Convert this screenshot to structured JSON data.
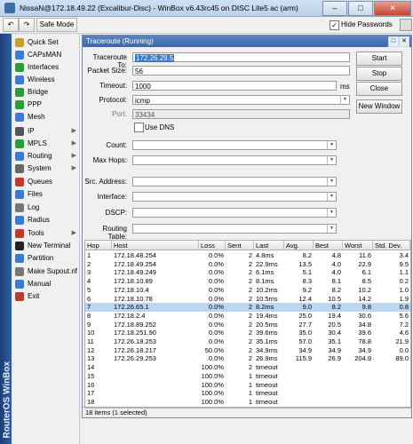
{
  "window": {
    "title": "NissaN@172.18.49.22 (Excalibur-Disc) - WinBox v6.43rc45 on DISC Lite5 ac (arm)"
  },
  "toolbar": {
    "safe_mode_label": "Safe Mode",
    "hide_passwords_label": "Hide Passwords",
    "hide_passwords_checked": true
  },
  "sidebar": {
    "brand": "RouterOS WinBox",
    "items": [
      {
        "label": "Quick Set",
        "icon": "quick-set-icon",
        "submenu": false,
        "color": "#c8a030"
      },
      {
        "label": "CAPsMAN",
        "icon": "capsman-icon",
        "submenu": false,
        "color": "#3a7bd5"
      },
      {
        "label": "Interfaces",
        "icon": "interfaces-icon",
        "submenu": false,
        "color": "#2a9d3a"
      },
      {
        "label": "Wireless",
        "icon": "wireless-icon",
        "submenu": false,
        "color": "#3a7bd5"
      },
      {
        "label": "Bridge",
        "icon": "bridge-icon",
        "submenu": false,
        "color": "#2a9d3a"
      },
      {
        "label": "PPP",
        "icon": "ppp-icon",
        "submenu": false,
        "color": "#2a9d3a"
      },
      {
        "label": "Mesh",
        "icon": "mesh-icon",
        "submenu": false,
        "color": "#3a7bd5"
      },
      {
        "label": "IP",
        "icon": "ip-icon",
        "submenu": true,
        "color": "#555555"
      },
      {
        "label": "MPLS",
        "icon": "mpls-icon",
        "submenu": true,
        "color": "#2a9d3a"
      },
      {
        "label": "Routing",
        "icon": "routing-icon",
        "submenu": true,
        "color": "#3a7bd5"
      },
      {
        "label": "System",
        "icon": "system-icon",
        "submenu": true,
        "color": "#666666"
      },
      {
        "label": "Queues",
        "icon": "queues-icon",
        "submenu": false,
        "color": "#c0392b"
      },
      {
        "label": "Files",
        "icon": "files-icon",
        "submenu": false,
        "color": "#3a7bd5"
      },
      {
        "label": "Log",
        "icon": "log-icon",
        "submenu": false,
        "color": "#777777"
      },
      {
        "label": "Radius",
        "icon": "radius-icon",
        "submenu": false,
        "color": "#3a7bd5"
      },
      {
        "label": "Tools",
        "icon": "tools-icon",
        "submenu": true,
        "color": "#c0392b"
      },
      {
        "label": "New Terminal",
        "icon": "terminal-icon",
        "submenu": false,
        "color": "#222222"
      },
      {
        "label": "Partition",
        "icon": "partition-icon",
        "submenu": false,
        "color": "#3a7bd5"
      },
      {
        "label": "Make Supout.rif",
        "icon": "supout-icon",
        "submenu": false,
        "color": "#777777"
      },
      {
        "label": "Manual",
        "icon": "manual-icon",
        "submenu": false,
        "color": "#3a7bd5"
      },
      {
        "label": "Exit",
        "icon": "exit-icon",
        "submenu": false,
        "color": "#c0392b"
      }
    ]
  },
  "dialog": {
    "title": "Traceroute (Running)",
    "form": {
      "traceroute_to_label": "Traceroute To:",
      "traceroute_to_value": "172.26.29.5",
      "packet_size_label": "Packet Size:",
      "packet_size_value": "56",
      "timeout_label": "Timeout:",
      "timeout_value": "1000",
      "timeout_unit": "ms",
      "protocol_label": "Protocol:",
      "protocol_value": "icmp",
      "port_label": "Port:",
      "port_value": "33434",
      "use_dns_label": "Use DNS",
      "count_label": "Count:",
      "max_hops_label": "Max Hops:",
      "src_address_label": "Src. Address:",
      "interface_label": "Interface:",
      "dscp_label": "DSCP:",
      "routing_table_label": "Routing Table:"
    },
    "buttons": {
      "start": "Start",
      "stop": "Stop",
      "close": "Close",
      "new_window": "New Window"
    },
    "table": {
      "headers": [
        "Hop",
        "Host",
        "Loss",
        "Sent",
        "Last",
        "Avg.",
        "Best",
        "Worst",
        "Std. Dev."
      ],
      "rows": [
        [
          "1",
          "172.18.48.254",
          "0.0%",
          "2",
          "4.8ms",
          "8.2",
          "4.8",
          "11.6",
          "3.4"
        ],
        [
          "2",
          "172.18.49.254",
          "0.0%",
          "2",
          "22.9ms",
          "13.5",
          "4.0",
          "22.9",
          "9.5"
        ],
        [
          "3",
          "172.18.49.249",
          "0.0%",
          "2",
          "6.1ms",
          "5.1",
          "4.0",
          "6.1",
          "1.1"
        ],
        [
          "4",
          "172.18.10.89",
          "0.0%",
          "2",
          "8.1ms",
          "8.3",
          "8.1",
          "8.5",
          "0.2"
        ],
        [
          "5",
          "172.18.10.4",
          "0.0%",
          "2",
          "10.2ms",
          "9.2",
          "8.2",
          "10.2",
          "1.0"
        ],
        [
          "6",
          "172.18.10.78",
          "0.0%",
          "2",
          "10.5ms",
          "12.4",
          "10.5",
          "14.2",
          "1.9"
        ],
        [
          "7",
          "172.26.65.1",
          "0.0%",
          "2",
          "8.2ms",
          "9.0",
          "8.2",
          "9.8",
          "0.8"
        ],
        [
          "8",
          "172.18.2.4",
          "0.0%",
          "2",
          "19.4ms",
          "25.0",
          "19.4",
          "30.6",
          "5.6"
        ],
        [
          "9",
          "172.18.89.252",
          "0.0%",
          "2",
          "20.5ms",
          "27.7",
          "20.5",
          "34.8",
          "7.2"
        ],
        [
          "10",
          "172.18.251.90",
          "0.0%",
          "2",
          "39.6ms",
          "35.0",
          "30.4",
          "39.6",
          "4.6"
        ],
        [
          "11",
          "172.26.18.253",
          "0.0%",
          "2",
          "35.1ms",
          "57.0",
          "35.1",
          "78.8",
          "21.9"
        ],
        [
          "12",
          "172.26.18.217",
          "50.0%",
          "2",
          "34.9ms",
          "34.9",
          "34.9",
          "34.9",
          "0.0"
        ],
        [
          "13",
          "172.26.29.253",
          "0.0%",
          "2",
          "26.9ms",
          "115.9",
          "26.9",
          "204.9",
          "89.0"
        ],
        [
          "14",
          "",
          "100.0%",
          "2",
          "timeout",
          "",
          "",
          "",
          ""
        ],
        [
          "15",
          "",
          "100.0%",
          "1",
          "timeout",
          "",
          "",
          "",
          ""
        ],
        [
          "16",
          "",
          "100.0%",
          "1",
          "timeout",
          "",
          "",
          "",
          ""
        ],
        [
          "17",
          "",
          "100.0%",
          "1",
          "timeout",
          "",
          "",
          "",
          ""
        ],
        [
          "18",
          "",
          "100.0%",
          "1",
          "timeout",
          "",
          "",
          "",
          ""
        ]
      ],
      "selected_row": 6
    },
    "status": "18 items (1 selected)"
  }
}
